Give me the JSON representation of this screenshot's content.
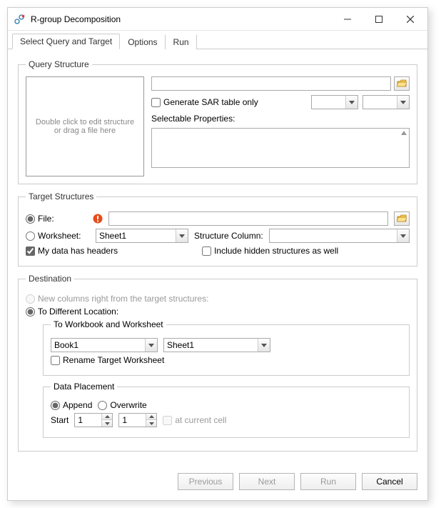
{
  "window": {
    "title": "R-group Decomposition"
  },
  "tabs": {
    "select": "Select Query and Target",
    "options": "Options",
    "run": "Run"
  },
  "query": {
    "legend": "Query Structure",
    "placeholder": "Double click to edit structure\nor drag a file here",
    "path_value": "",
    "sar_label": "Generate SAR table only",
    "sar_checked": false,
    "selectable_label": "Selectable Properties:",
    "combo1": "",
    "combo2": ""
  },
  "target": {
    "legend": "Target Structures",
    "file_label": "File:",
    "file_value": "",
    "file_selected": true,
    "worksheet_label": "Worksheet:",
    "worksheet_value": "Sheet1",
    "worksheet_selected": false,
    "struct_col_label": "Structure Column:",
    "struct_col_value": "",
    "headers_label": "My data has headers",
    "headers_checked": true,
    "hidden_label": "Include hidden structures as well",
    "hidden_checked": false
  },
  "dest": {
    "legend": "Destination",
    "new_cols_label": "New columns right from the target structures:",
    "new_cols_selected": false,
    "diff_loc_label": "To Different Location:",
    "diff_loc_selected": true,
    "to_wb_legend": "To Workbook and Worksheet",
    "workbook_value": "Book1",
    "sheet_value": "Sheet1",
    "rename_label": "Rename Target Worksheet",
    "rename_checked": false,
    "placement_legend": "Data Placement",
    "append_label": "Append",
    "append_selected": true,
    "overwrite_label": "Overwrite",
    "overwrite_selected": false,
    "start_label": "Start",
    "start_col": "1",
    "start_row": "1",
    "at_cell_label": "at current cell",
    "at_cell_checked": false
  },
  "footer": {
    "previous": "Previous",
    "next": "Next",
    "run": "Run",
    "cancel": "Cancel"
  }
}
